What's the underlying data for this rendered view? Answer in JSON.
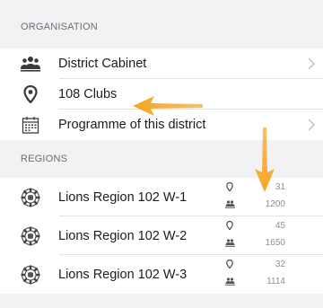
{
  "organisation": {
    "header": "ORGANISATION",
    "items": [
      {
        "label": "District Cabinet",
        "icon": "people-icon"
      },
      {
        "label": "108 Clubs",
        "icon": "location-pin-icon"
      },
      {
        "label": "Programme of this district",
        "icon": "calendar-icon"
      }
    ]
  },
  "regions": {
    "header": "REGIONS",
    "items": [
      {
        "label": "Lions Region 102 W-1",
        "clubs": "31",
        "members": "1200",
        "icon": "lions-logo-icon"
      },
      {
        "label": "Lions Region 102 W-2",
        "clubs": "45",
        "members": "1650",
        "icon": "lions-logo-icon"
      },
      {
        "label": "Lions Region 102 W-3",
        "clubs": "32",
        "members": "1114",
        "icon": "lions-logo-icon"
      }
    ]
  },
  "colors": {
    "annotation_arrow": "#f5a623",
    "background": "#f2f2f4",
    "row": "#ffffff"
  }
}
